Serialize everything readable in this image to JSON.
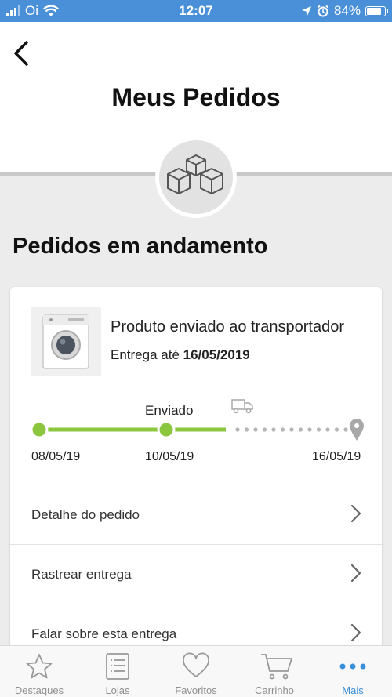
{
  "status_bar": {
    "carrier": "Oi",
    "time": "12:07",
    "battery": "84%",
    "battery_level": 0.84
  },
  "header": {
    "title": "Meus Pedidos"
  },
  "section": {
    "title": "Pedidos em andamento"
  },
  "order": {
    "status": "Produto enviado ao transportador",
    "delivery_prefix": "Entrega até",
    "delivery_date": "16/05/2019",
    "tracking": {
      "current_label": "Enviado",
      "dates": [
        "08/05/19",
        "10/05/19",
        "16/05/19"
      ],
      "colors": {
        "done": "#8cc63f",
        "pending": "#b5b5b5"
      }
    },
    "actions": [
      "Detalhe do pedido",
      "Rastrear entrega",
      "Falar sobre esta entrega"
    ]
  },
  "tabs": [
    {
      "label": "Destaques",
      "icon": "star-icon"
    },
    {
      "label": "Lojas",
      "icon": "list-icon"
    },
    {
      "label": "Favoritos",
      "icon": "heart-icon"
    },
    {
      "label": "Carrinho",
      "icon": "cart-icon"
    },
    {
      "label": "Mais",
      "icon": "more-icon",
      "active": true
    }
  ],
  "colors": {
    "status_bar": "#4a90d9",
    "accent": "#3a8fd9",
    "progress": "#8cc63f"
  }
}
